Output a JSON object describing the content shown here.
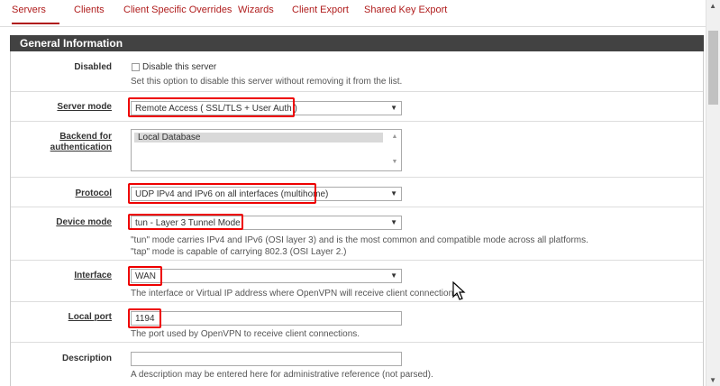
{
  "tabs": [
    {
      "label": "Servers"
    },
    {
      "label": "Clients"
    },
    {
      "label": "Client Specific Overrides"
    },
    {
      "label": "Wizards"
    },
    {
      "label": "Client Export"
    },
    {
      "label": "Shared Key Export"
    }
  ],
  "section": {
    "title": "General Information"
  },
  "disabled": {
    "label": "Disabled",
    "checkbox_label": "Disable this server",
    "help": "Set this option to disable this server without removing it from the list."
  },
  "server_mode": {
    "label": "Server mode",
    "value": "Remote Access ( SSL/TLS + User Auth )"
  },
  "backend": {
    "label_line1": "Backend for",
    "label_line2": "authentication",
    "option": "Local Database"
  },
  "protocol": {
    "label": "Protocol",
    "value": "UDP IPv4 and IPv6 on all interfaces (multihome)"
  },
  "device_mode": {
    "label": "Device mode",
    "value": "tun - Layer 3 Tunnel Mode",
    "help_line1": "\"tun\" mode carries IPv4 and IPv6 (OSI layer 3) and is the most common and compatible mode across all platforms.",
    "help_line2": "\"tap\" mode is capable of carrying 802.3 (OSI Layer 2.)"
  },
  "interface": {
    "label": "Interface",
    "value": "WAN",
    "help": "The interface or Virtual IP address where OpenVPN will receive client connections."
  },
  "local_port": {
    "label": "Local port",
    "value": "1194",
    "help": "The port used by OpenVPN to receive client connections."
  },
  "description": {
    "label": "Description",
    "value": "",
    "help": "A description may be entered here for administrative reference (not parsed)."
  },
  "colors": {
    "accent": "#b01c1c",
    "highlight": "#e00000",
    "header_bg": "#424242"
  },
  "icons": {
    "dropdown": "triangle-down",
    "scroll_up": "triangle-up",
    "scroll_down": "triangle-down",
    "cursor": "mouse-pointer"
  }
}
